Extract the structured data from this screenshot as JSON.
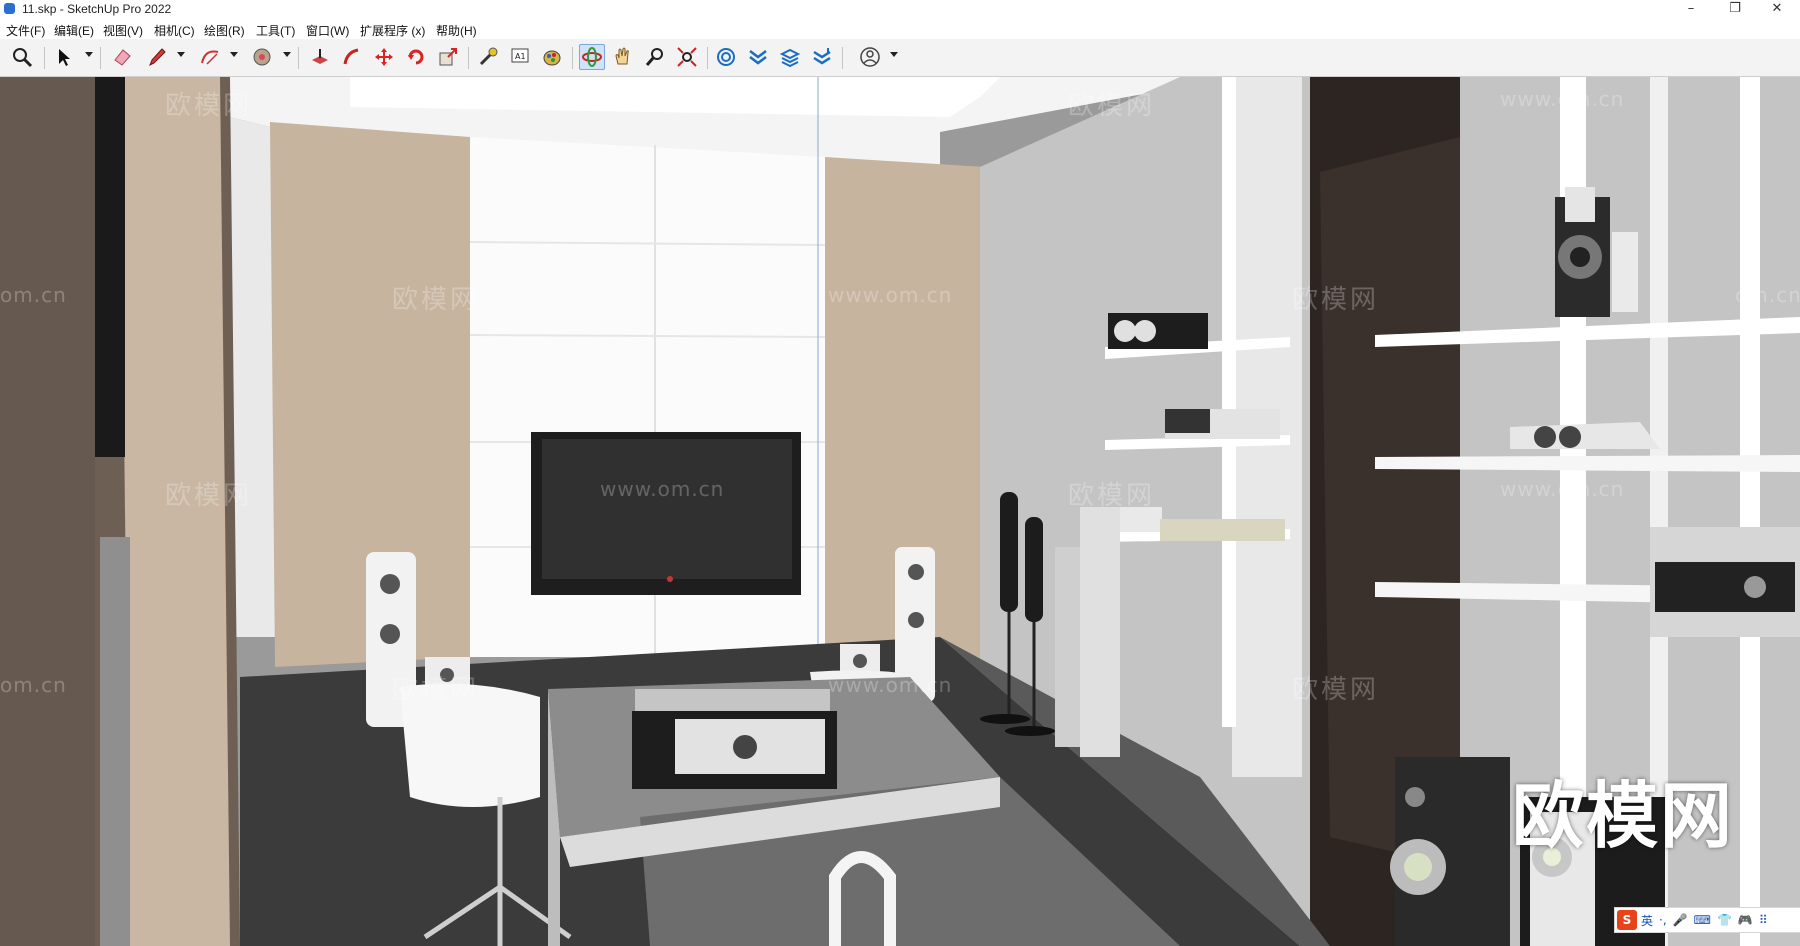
{
  "window": {
    "title": "11.skp - SketchUp Pro 2022",
    "controls": {
      "minimize": "–",
      "restore": "❐",
      "close": "✕"
    }
  },
  "menu": {
    "items": [
      "文件(F)",
      "编辑(E)",
      "视图(V)",
      "相机(C)",
      "绘图(R)",
      "工具(T)",
      "窗口(W)",
      "扩展程序 (x)",
      "帮助(H)"
    ]
  },
  "toolbar": {
    "tools": [
      {
        "name": "zoom-icon"
      },
      {
        "name": "select-icon"
      },
      {
        "name": "eraser-icon"
      },
      {
        "name": "pencil-line-icon"
      },
      {
        "name": "arc-icon"
      },
      {
        "name": "paint-bucket-icon"
      },
      {
        "name": "push-pull-icon"
      },
      {
        "name": "follow-me-icon"
      },
      {
        "name": "move-icon"
      },
      {
        "name": "rotate-icon"
      },
      {
        "name": "scale-icon"
      },
      {
        "name": "tape-measure-icon"
      },
      {
        "name": "text-icon"
      },
      {
        "name": "paint-icon"
      },
      {
        "name": "orbit-icon"
      },
      {
        "name": "pan-icon"
      },
      {
        "name": "zoom-magnify-icon"
      },
      {
        "name": "zoom-extents-icon"
      },
      {
        "name": "3d-warehouse-icon"
      },
      {
        "name": "extension-warehouse-icon"
      },
      {
        "name": "layout-icon"
      },
      {
        "name": "extension-manager-icon"
      },
      {
        "name": "account-icon"
      }
    ],
    "active_tool": "orbit-icon",
    "text_tool_label": "A1"
  },
  "viewport": {
    "watermark_brand": "欧模网",
    "watermark_url": "www.om.cn",
    "watermark_partial": "om.cn",
    "large_watermark": "欧模网"
  },
  "ime": {
    "logo": "S",
    "items": [
      "英",
      "·,",
      "🎤",
      "⌨",
      "👕",
      "🎮",
      "⠿"
    ]
  },
  "colors": {
    "toolbar_bg": "#f3f3f3",
    "active_tool_bg": "#cfe2f7",
    "wall_gray": "#b9b9b9",
    "wood_panel": "#c7b49f",
    "tv_screen": "#2a2a2a",
    "floor": "#3d3d3d"
  }
}
